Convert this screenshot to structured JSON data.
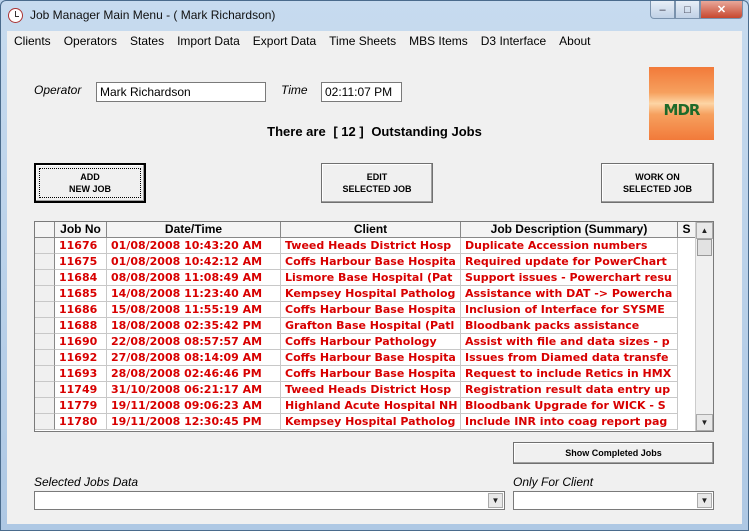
{
  "window": {
    "title": "Job Manager Main Menu - ( Mark Richardson)",
    "minimize_glyph": "–",
    "maximize_glyph": "□",
    "close_glyph": "✕"
  },
  "menu": [
    "Clients",
    "Operators",
    "States",
    "Import Data",
    "Export Data",
    "Time Sheets",
    "MBS Items",
    "D3 Interface",
    "About"
  ],
  "form": {
    "operator_label": "Operator",
    "operator_value": "Mark Richardson",
    "time_label": "Time",
    "time_value": "02:11:07 PM",
    "headline_prefix": "There are",
    "headline_count": "[ 12 ]",
    "headline_suffix": "Outstanding Jobs"
  },
  "logo": {
    "text": "MDR"
  },
  "buttons": {
    "add_line1": "ADD",
    "add_line2": "NEW JOB",
    "edit_line1": "EDIT",
    "edit_line2": "SELECTED JOB",
    "work_line1": "WORK ON",
    "work_line2": "SELECTED JOB",
    "show_completed": "Show Completed Jobs"
  },
  "grid": {
    "columns": [
      "Job No",
      "Date/Time",
      "Client",
      "Job Description (Summary)",
      "S"
    ],
    "rows": [
      [
        "11676",
        "01/08/2008  10:43:20 AM",
        "Tweed Heads District Hosp",
        "Duplicate Accession numbers"
      ],
      [
        "11675",
        "01/08/2008  10:42:12 AM",
        "Coffs Harbour Base Hospita",
        "Required update for PowerChart"
      ],
      [
        "11684",
        "08/08/2008  11:08:49 AM",
        "Lismore Base Hospital (Pat",
        "Support issues - Powerchart resu"
      ],
      [
        "11685",
        "14/08/2008  11:23:40 AM",
        "Kempsey Hospital Patholog",
        "Assistance with DAT -> Powercha"
      ],
      [
        "11686",
        "15/08/2008  11:55:19 AM",
        "Coffs Harbour Base Hospita",
        "Inclusion of Interface for SYSME"
      ],
      [
        "11688",
        "18/08/2008  02:35:42 PM",
        "Grafton Base Hospital (Patl",
        "Bloodbank packs assistance"
      ],
      [
        "11690",
        "22/08/2008  08:57:57 AM",
        "Coffs Harbour Pathology",
        "Assist with file and data sizes - p"
      ],
      [
        "11692",
        "27/08/2008  08:14:09 AM",
        "Coffs Harbour Base Hospita",
        "Issues from Diamed data transfe"
      ],
      [
        "11693",
        "28/08/2008  02:46:46 PM",
        "Coffs Harbour Base Hospita",
        "Request to include Retics in HMX"
      ],
      [
        "11749",
        "31/10/2008  06:21:17 AM",
        "Tweed Heads District Hosp",
        "Registration result data entry up"
      ],
      [
        "11779",
        "19/11/2008  09:06:23 AM",
        "Highland Acute Hospital NH",
        "Bloodbank Upgrade for WICK - S"
      ],
      [
        "11780",
        "19/11/2008  12:30:45 PM",
        "Kempsey Hospital Patholog",
        "Include INR into coag report pag"
      ]
    ]
  },
  "bottom": {
    "selected_jobs_label": "Selected Jobs Data",
    "only_for_client_label": "Only For Client"
  },
  "colors": {
    "row_text": "#d80000",
    "window_frame": "#b9d1ea",
    "logo_orange": "#f27a3a",
    "logo_green": "#1d6a2a"
  }
}
